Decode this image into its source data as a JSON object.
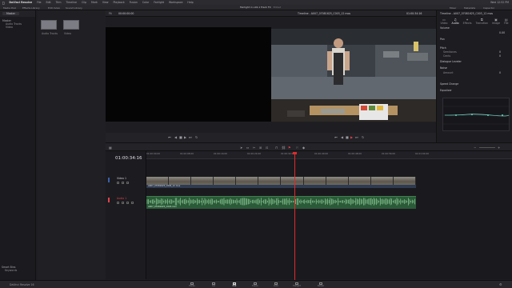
{
  "menubar": {
    "app": "DaVinci Resolve",
    "items": [
      "File",
      "Edit",
      "Trim",
      "Timeline",
      "Clip",
      "Mark",
      "View",
      "Playback",
      "Fusion",
      "Color",
      "Fairlight",
      "Workspace",
      "Help"
    ],
    "status": "Wed 12:52 PM"
  },
  "toolbar": {
    "media_pool": "Media Pool",
    "effects": "Effects Library",
    "edit_index": "Edit Index",
    "sound_library": "Sound Library",
    "project": "Fairlight in v16.1 Track FX",
    "edited": "Edited",
    "mixer": "Mixer",
    "metadata": "Metadata",
    "inspector": "Inspector"
  },
  "media_pool": {
    "bin_dropdown": "Master",
    "tree_root": "Master",
    "tree_items": [
      "Audio Tracks",
      "Video"
    ],
    "smart_bins": "Smart Bins",
    "smart_items": [
      "Keywords"
    ]
  },
  "clips": {
    "items": [
      {
        "name": "Audio Tracks"
      },
      {
        "name": "Video"
      }
    ]
  },
  "viewer": {
    "zoom": "Fit",
    "source_tc": "00:00:00:00",
    "timeline_name": "Timeline - A007_07081625_C003_12 mos",
    "record_tc": "01:00:34:16",
    "duration": "00:01:12:01"
  },
  "inspector": {
    "title": "Timeline - A007_07081625_C003_12 mos",
    "tabs": [
      "Video",
      "Audio",
      "Effects",
      "Transition",
      "Image",
      "File"
    ],
    "active_tab": "Audio",
    "sections": {
      "volume": "Volume",
      "volume_value": "0.00",
      "pan": "Pan",
      "pitch": "Pitch",
      "pitch_semitones": "Semitones",
      "pitch_semitones_value": "0",
      "pitch_cents": "Cents",
      "pitch_cents_value": "0",
      "dialogue_leveler": "Dialogue Leveler",
      "noise": "Noise",
      "noise_amount": "Amount",
      "noise_amount_value": "0",
      "speed_change": "Speed Change",
      "equalizer": "Equalizer"
    }
  },
  "timeline": {
    "timecode": "01:00:34:16",
    "ruler_ticks": [
      "01:00:00:00",
      "01:00:08:00",
      "01:00:16:00",
      "01:00:24:00",
      "01:00:32:00",
      "01:00:40:00",
      "01:00:48:00",
      "01:00:56:00",
      "01:01:04:00"
    ],
    "tracks": [
      {
        "id": "V1",
        "name": "Video 1",
        "clip_label": "A007_07081625_C003_12 mos"
      },
      {
        "id": "A1",
        "name": "Audio 1",
        "clip_label": "A007_07081625_C003.mov"
      }
    ]
  },
  "pagebar": {
    "title": "DaVinci Resolve 16",
    "pages": [
      "Media",
      "Cut",
      "Edit",
      "Fusion",
      "Color",
      "Fairlight",
      "Deliver"
    ],
    "active_page": "Edit"
  },
  "colors": {
    "video_clip": "#2f3b52",
    "audio_clip": "#2b5a38",
    "playhead": "#e02a2a",
    "accent": "#e0424a"
  }
}
